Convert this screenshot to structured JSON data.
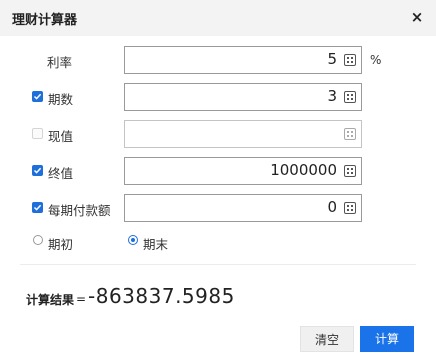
{
  "window": {
    "title": "理财计算器"
  },
  "fields": [
    {
      "label": "利率",
      "value": "5",
      "unit": "%",
      "has_checkbox": false
    },
    {
      "label": "期数",
      "value": "3",
      "checked": true
    },
    {
      "label": "现值",
      "value": "",
      "checked": false
    },
    {
      "label": "终值",
      "value": "1000000",
      "checked": true
    },
    {
      "label": "每期付款额",
      "value": "0",
      "checked": true
    }
  ],
  "timing": {
    "options": [
      "期初",
      "期末"
    ],
    "selected": "期末"
  },
  "result": {
    "label": "计算结果",
    "equals": "=",
    "value": "-863837.5985"
  },
  "buttons": {
    "clear": "清空",
    "calculate": "计算"
  },
  "colors": {
    "accent": "#1a73e8",
    "titlebar": "#f3f3f3"
  }
}
